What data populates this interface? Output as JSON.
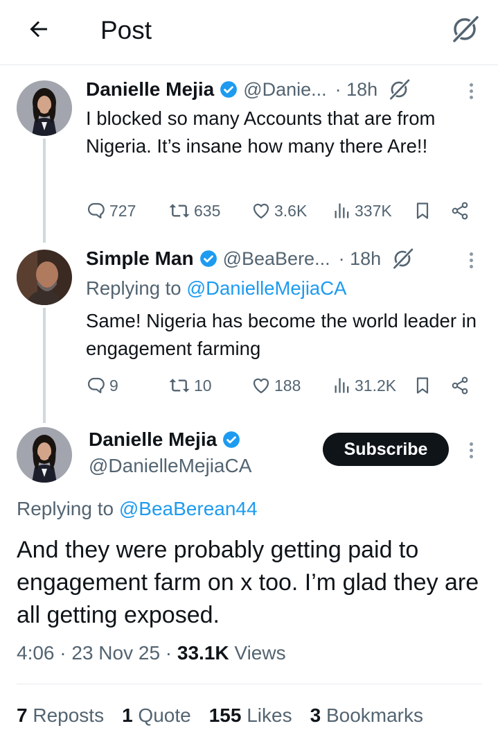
{
  "header": {
    "title": "Post",
    "back_icon": "arrow-left-icon",
    "grok_icon": "grok-icon"
  },
  "tweets": [
    {
      "name": "Danielle Mejia",
      "handle": "@Danie...",
      "time": "· 18h",
      "text": "I blocked so many Accounts that are from Nigeria. It’s insane how many there Are!!",
      "replies": "727",
      "reposts": "635",
      "likes": "3.6K",
      "views": "337K"
    },
    {
      "name": "Simple Man",
      "handle": "@BeaBere...",
      "time": "· 18h",
      "replying_prefix": "Replying to ",
      "replying_to": "@DanielleMejiaCA",
      "text": "Same!  Nigeria has become the world leader in engagement farming",
      "replies": "9",
      "reposts": "10",
      "likes": "188",
      "views": "31.2K"
    }
  ],
  "main": {
    "name": "Danielle Mejia",
    "handle": "@DanielleMejiaCA",
    "subscribe_label": "Subscribe",
    "replying_prefix": "Replying to ",
    "replying_to": "@BeaBerean44",
    "text": "And they were probably getting paid to engagement farm on x too. I’m glad they are all getting exposed.",
    "time": "4:06 · 23 Nov 25 · ",
    "views_count": "33.1K",
    "views_label": " Views",
    "stats": [
      {
        "count": "7",
        "label": " Reposts"
      },
      {
        "count": "1",
        "label": " Quote"
      },
      {
        "count": "155",
        "label": " Likes"
      },
      {
        "count": "3",
        "label": " Bookmarks"
      }
    ]
  },
  "colors": {
    "accent": "#1d9bf0",
    "text": "#0f1419",
    "secondary": "#536471",
    "button": "#0f1419"
  }
}
